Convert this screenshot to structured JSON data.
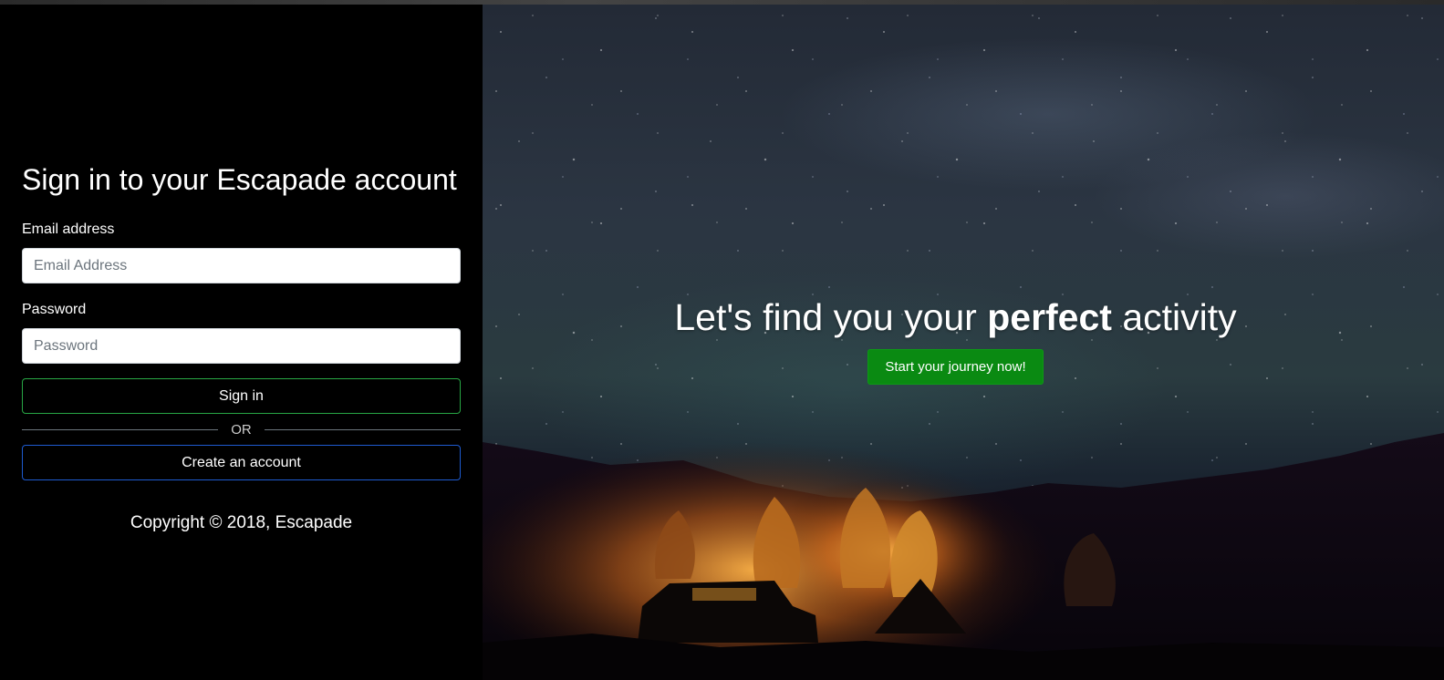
{
  "signin": {
    "title": "Sign in to your Escapade account",
    "email_label": "Email address",
    "email_placeholder": "Email Address",
    "email_value": "",
    "password_label": "Password",
    "password_placeholder": "Password",
    "password_value": "",
    "signin_button": "Sign in",
    "divider_text": "OR",
    "create_button": "Create an account",
    "copyright": "Copyright © 2018, Escapade"
  },
  "hero": {
    "headline_pre": "Let's find you your ",
    "headline_bold": "perfect",
    "headline_post": " activity",
    "cta_button": "Start your journey now!",
    "background_icon": "night-sky-campfire-image"
  },
  "colors": {
    "cta_green": "#0a8a12",
    "signin_border": "#28a745",
    "create_border": "#1e5bd0"
  }
}
